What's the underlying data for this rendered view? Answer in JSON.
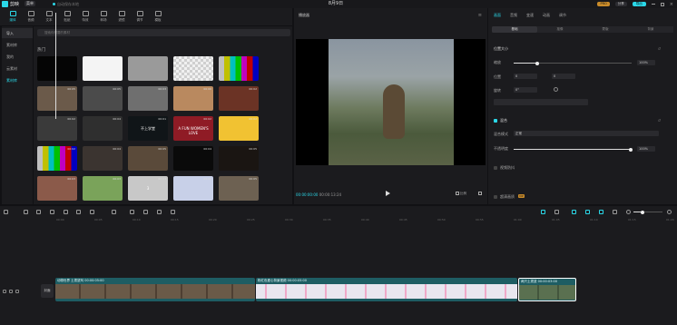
{
  "app": {
    "name": "剪映",
    "menu_label": "菜单",
    "autosave": "自动保存本地",
    "title": "8月9日"
  },
  "topbar": {
    "pro_badge": "会员",
    "pro_label": "PRO",
    "share_label": "分享",
    "export_label": "导出"
  },
  "tools": [
    "媒体",
    "音频",
    "文本",
    "贴纸",
    "特效",
    "转场",
    "滤镜",
    "调节",
    "模板"
  ],
  "left_nav": [
    "导入",
    "素材库",
    "我的",
    "云素材",
    "素材库"
  ],
  "media": {
    "search_placeholder": "搜索你想要的素材",
    "section_label": "热门",
    "thumbs": [
      {
        "dur": "",
        "label": "",
        "color": "#050505"
      },
      {
        "dur": "",
        "label": "",
        "color": "#f4f4f4"
      },
      {
        "dur": "",
        "label": "",
        "color": "#9a9a9a"
      },
      {
        "dur": "",
        "label": "",
        "color": "#d9d9d9"
      },
      {
        "dur": "",
        "label": "",
        "color": "#7a7a7a"
      },
      {
        "dur": "00:05",
        "label": "",
        "color": "#6b5a4a"
      },
      {
        "dur": "00:05",
        "label": "",
        "color": "#4b4b4b"
      },
      {
        "dur": "00:03",
        "label": "",
        "color": "#6f6f6f"
      },
      {
        "dur": "00:06",
        "label": "",
        "color": "#b9895f"
      },
      {
        "dur": "00:02",
        "label": "",
        "color": "#6b3325"
      },
      {
        "dur": "00:02",
        "label": "",
        "color": "#3a3a3a"
      },
      {
        "dur": "00:04",
        "label": "",
        "color": "#2f2f2f"
      },
      {
        "dur": "00:01",
        "label": "不上学堂",
        "color": "#101518"
      },
      {
        "dur": "00:02",
        "label": "A FUN WOMEN'S LOVE",
        "color": "#8f1b25"
      },
      {
        "dur": "00:02",
        "label": "",
        "color": "#f1c232"
      },
      {
        "dur": "00:02",
        "label": "",
        "color": "#6ec7b2"
      },
      {
        "dur": "00:04",
        "label": "",
        "color": "#3b3430"
      },
      {
        "dur": "00:05",
        "label": "",
        "color": "#5a4a3a"
      },
      {
        "dur": "00:04",
        "label": "",
        "color": "#0a0a0a"
      },
      {
        "dur": "00:05",
        "label": "",
        "color": "#1a1512"
      },
      {
        "dur": "00:03",
        "label": "",
        "color": "#8b5a4a"
      },
      {
        "dur": "00:03",
        "label": "",
        "color": "#7aa35a"
      },
      {
        "dur": "00:04",
        "label": "3",
        "color": "#c8c8c8"
      },
      {
        "dur": "00:02",
        "label": "",
        "color": "#c8d0e8"
      },
      {
        "dur": "00:05",
        "label": "",
        "color": "#6d6152"
      }
    ]
  },
  "player": {
    "title": "播放器",
    "current": "00:00:00:00",
    "total": "00:00:13:24",
    "ratio_label": "比例"
  },
  "props": {
    "tabs": [
      "画面",
      "音频",
      "变速",
      "动画",
      "调节"
    ],
    "subtabs": [
      "基础",
      "抠像",
      "蒙版",
      "背景"
    ],
    "size_section": "位置大小",
    "scale_label": "缩放",
    "scale_value": "100%",
    "position_label": "位置",
    "pos_x": "0",
    "pos_y": "0",
    "rotate_label": "旋转",
    "rotate_value": "0°",
    "blend_section": "混合",
    "blend_mode_label": "混合模式",
    "blend_mode_value": "正常",
    "opacity_label": "不透明度",
    "opacity_value": "100%",
    "stabilize_label": "视频防抖",
    "ai_label": "超清画质",
    "ai_badge": "VIP"
  },
  "timeline": {
    "track_cover": "封面",
    "ticks": [
      "00:00",
      "00:05",
      "00:10",
      "00:15",
      "00:20",
      "00:25",
      "00:30",
      "00:35",
      "00:40",
      "00:45",
      "00:50",
      "00:55",
      "01:00",
      "01:05",
      "01:10",
      "01:15",
      "01:20"
    ],
    "clips": [
      {
        "title": "动物世界 土拨鼠叫 00:00:05:00",
        "color": "#6a5a48"
      },
      {
        "title": "粉红色爱心背景视频 00:00:05:00",
        "color": "#e8e6ef"
      },
      {
        "title": "两只土拨鼠 00:00:03:00",
        "color": "#5a7050"
      }
    ]
  }
}
